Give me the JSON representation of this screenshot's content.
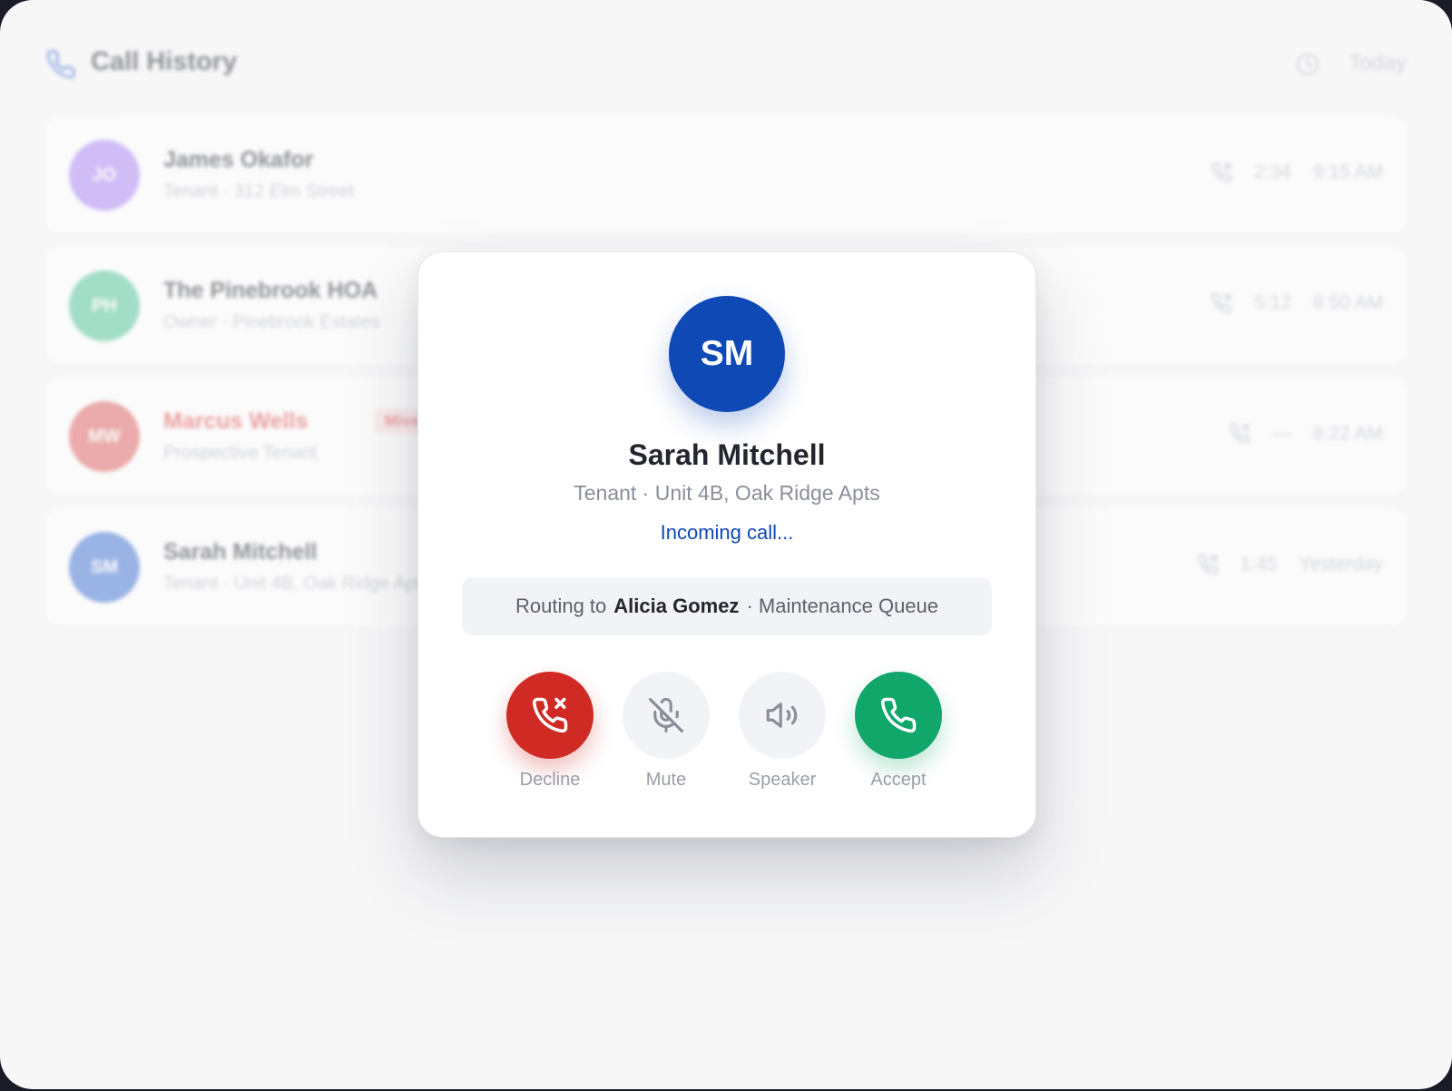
{
  "history": {
    "title": "Call History",
    "filter_label": "Today",
    "rows": [
      {
        "initials": "JO",
        "name": "James Okafor",
        "subtitle": "Tenant · 312 Elm Street",
        "duration": "2:34",
        "time": "9:15 AM",
        "avatar_color": "#b18ef5",
        "badge": ""
      },
      {
        "initials": "PH",
        "name": "The Pinebrook HOA",
        "subtitle": "Owner · Pinebrook Estates",
        "duration": "5:12",
        "time": "8:50 AM",
        "avatar_color": "#5ec9a0",
        "badge": ""
      },
      {
        "initials": "MW",
        "name": "Marcus Wells",
        "subtitle": "Prospective Tenant",
        "duration": "—",
        "time": "8:22 AM",
        "avatar_color": "#e26d6d",
        "badge": "Missed"
      },
      {
        "initials": "SM",
        "name": "Sarah Mitchell",
        "subtitle": "Tenant · Unit 4B, Oak Ridge Apts",
        "duration": "1:45",
        "time": "Yesterday",
        "avatar_color": "#4f7cd6",
        "badge": ""
      }
    ]
  },
  "incoming": {
    "initials": "SM",
    "name": "Sarah Mitchell",
    "subtitle": "Tenant · Unit 4B, Oak Ridge Apts",
    "status": "Incoming call...",
    "routing_prefix": "Routing to",
    "routing_agent": "Alicia Gomez",
    "routing_suffix": "· Maintenance Queue",
    "actions": {
      "decline": "Decline",
      "mute": "Mute",
      "speaker": "Speaker",
      "accept": "Accept"
    }
  },
  "colors": {
    "brand_blue": "#0e49b5",
    "decline_red": "#cf2a23",
    "accept_green": "#11a66a",
    "missed_red": "#e05a5a"
  },
  "icons": {
    "header": "phone-icon",
    "filter": "clock-icon",
    "row_duration": "phone-call-icon",
    "decline": "phone-x-icon",
    "mute": "mic-off-icon",
    "speaker": "speaker-icon",
    "accept": "phone-icon"
  }
}
